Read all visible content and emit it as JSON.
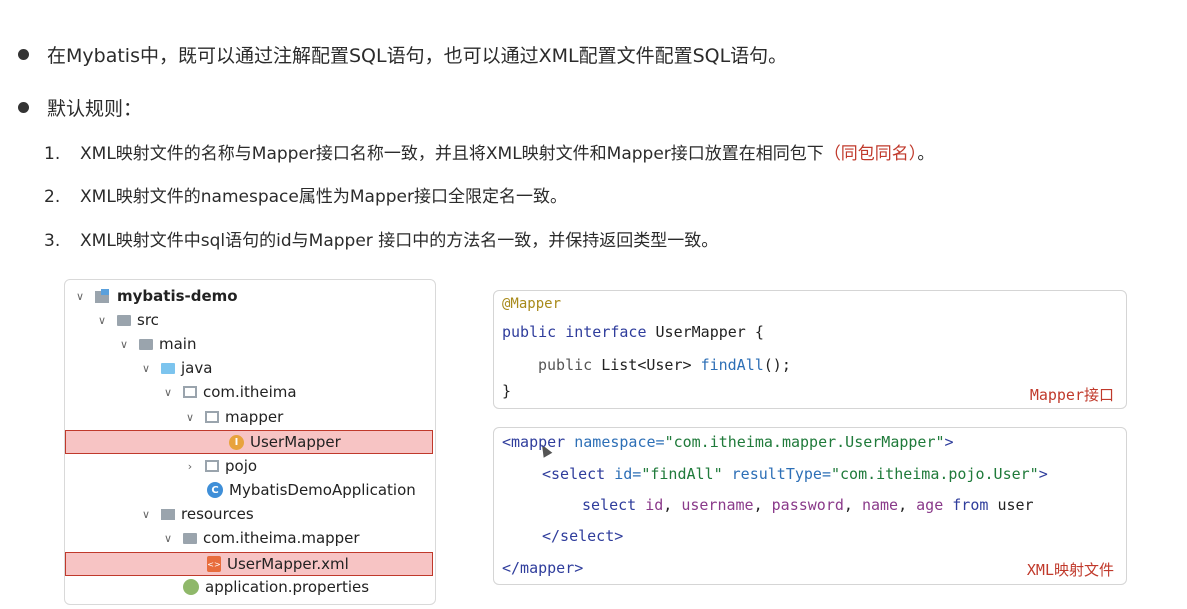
{
  "bullets": [
    "在Mybatis中，既可以通过注解配置SQL语句，也可以通过XML配置文件配置SQL语句。",
    "默认规则："
  ],
  "rules": [
    {
      "num": "1.",
      "text": "XML映射文件的名称与Mapper接口名称一致，并且将XML映射文件和Mapper接口放置在相同包下",
      "highlight": "（同包同名）",
      "end": "。"
    },
    {
      "num": "2.",
      "text": "XML映射文件的namespace属性为Mapper接口全限定名一致。"
    },
    {
      "num": "3.",
      "text": "XML映射文件中sql语句的id与Mapper 接口中的方法名一致，并保持返回类型一致。"
    }
  ],
  "tree": {
    "items": [
      {
        "label": "mybatis-demo"
      },
      {
        "label": "src"
      },
      {
        "label": "main"
      },
      {
        "label": "java"
      },
      {
        "label": "com.itheima"
      },
      {
        "label": "mapper"
      },
      {
        "label": "UserMapper"
      },
      {
        "label": "pojo"
      },
      {
        "label": "MybatisDemoApplication"
      },
      {
        "label": "resources"
      },
      {
        "label": "com.itheima.mapper"
      },
      {
        "label": "UserMapper.xml"
      },
      {
        "label": "application.properties"
      }
    ]
  },
  "mapper_code": {
    "annotation": "@Mapper",
    "line2_kw": "public interface ",
    "line2_name": "UserMapper {",
    "line3_kw": "public ",
    "line3_type": "List<User> ",
    "line3_fn": "findAll",
    "line3_end": "();",
    "line4": "}",
    "caption": "Mapper接口"
  },
  "xml_code": {
    "l1_tag": "<mapper ",
    "l1_attr": "namespace=",
    "l1_val": "\"com.itheima.mapper.UserMapper\"",
    "l1_end": ">",
    "l2_tag": "<select ",
    "l2_attr1": "id=",
    "l2_val1": "\"findAll\" ",
    "l2_attr2": "resultType=",
    "l2_val2": "\"com.itheima.pojo.User\"",
    "l2_end": ">",
    "l3_kw1": "select ",
    "l3_c1": "id",
    "l3_s1": ", ",
    "l3_c2": "username",
    "l3_s2": ", ",
    "l3_c3": "password",
    "l3_s3": ", ",
    "l3_c4": "name",
    "l3_s4": ", ",
    "l3_c5": "age ",
    "l3_kw2": "from ",
    "l3_tbl": "user",
    "l4": "</select>",
    "l5": "</mapper>",
    "caption": "XML映射文件"
  }
}
